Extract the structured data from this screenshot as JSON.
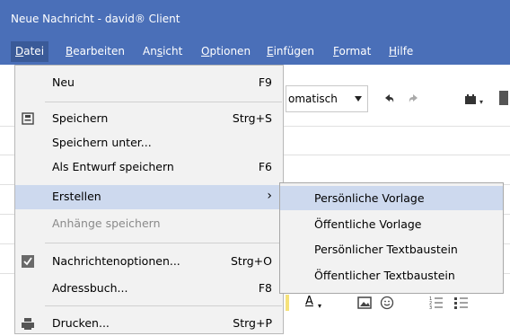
{
  "window": {
    "title": "Neue Nachricht - david® Client"
  },
  "menubar": {
    "items": [
      {
        "label": "Datei"
      },
      {
        "label": "Bearbeiten"
      },
      {
        "label": "Ansicht"
      },
      {
        "label": "Optionen"
      },
      {
        "label": "Einfügen"
      },
      {
        "label": "Format"
      },
      {
        "label": "Hilfe"
      }
    ]
  },
  "background": {
    "combo_value": "omatisch",
    "undo_icon": "undo-icon",
    "redo_icon": "redo-icon"
  },
  "datei_menu": {
    "items": [
      {
        "label": "Neu",
        "shortcut": "F9"
      },
      {
        "label": "Speichern",
        "shortcut": "Strg+S",
        "icon": "save-icon"
      },
      {
        "label": "Speichern unter...",
        "shortcut": ""
      },
      {
        "label": "Als Entwurf speichern",
        "shortcut": "F6"
      },
      {
        "label": "Erstellen",
        "shortcut": ""
      },
      {
        "label": "Anhänge speichern",
        "shortcut": ""
      },
      {
        "label": "Nachrichtenoptionen...",
        "shortcut": "Strg+O",
        "icon": "checkbox-icon"
      },
      {
        "label": "Adressbuch...",
        "shortcut": "F8"
      },
      {
        "label": "Drucken...",
        "shortcut": "Strg+P",
        "icon": "printer-icon"
      }
    ]
  },
  "erstellen_submenu": {
    "items": [
      {
        "label": "Persönliche Vorlage"
      },
      {
        "label": "Öffentliche Vorlage"
      },
      {
        "label": "Persönlicher Textbaustein"
      },
      {
        "label": "Öffentlicher Textbaustein"
      }
    ]
  },
  "colors": {
    "titlebar": "#4a6fb8",
    "highlight": "#cdd9ee",
    "menu_bg": "#f2f2f2"
  }
}
